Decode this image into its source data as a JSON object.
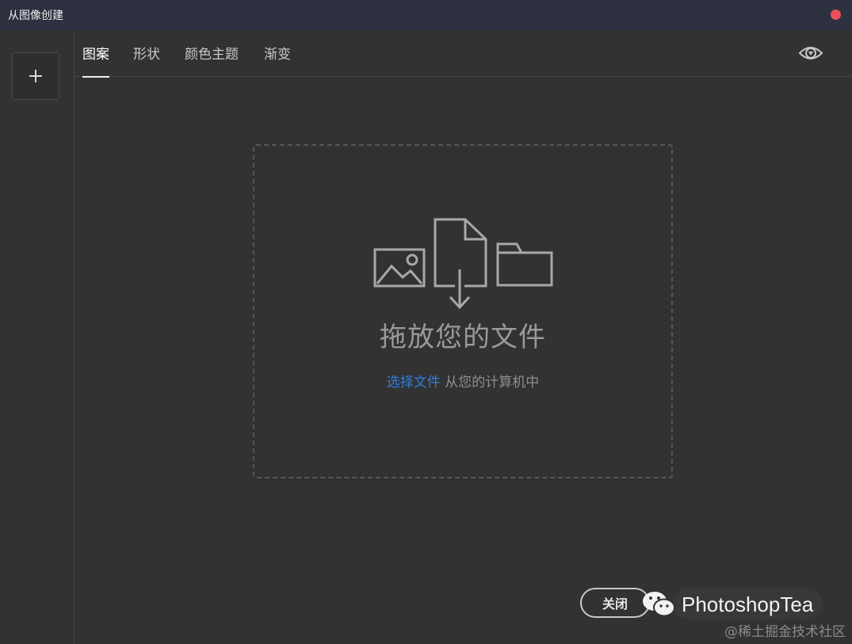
{
  "window": {
    "title": "从图像创建"
  },
  "sidebar": {
    "add_label": "+"
  },
  "tabs": [
    {
      "label": "图案",
      "active": true
    },
    {
      "label": "形状",
      "active": false
    },
    {
      "label": "颜色主题",
      "active": false
    },
    {
      "label": "渐变",
      "active": false
    }
  ],
  "dropzone": {
    "title": "拖放您的文件",
    "link_text": "选择文件",
    "sub_text": " 从您的计算机中",
    "icons": [
      "image-icon",
      "file-download-icon",
      "folder-icon"
    ]
  },
  "footer": {
    "close_label": "关闭",
    "watermark_text": "PhotoshopTea",
    "source_mark": "@稀土掘金技术社区"
  },
  "colors": {
    "background": "#323232",
    "titlebar": "#2d3140",
    "accent_link": "#2f7fe0",
    "close_dot": "#e8505b"
  }
}
